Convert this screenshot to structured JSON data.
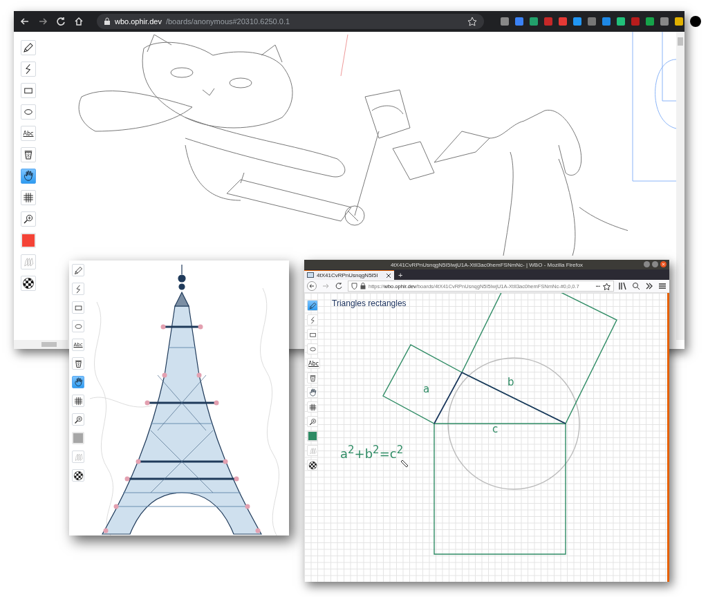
{
  "windows": [
    {
      "kind": "chrome",
      "url_host": "wbo.ophir.dev",
      "url_path": "/boards/anonymous#20310.6250.0.1",
      "tools": [
        {
          "kind": "pencil",
          "selected": false
        },
        {
          "kind": "line",
          "selected": false
        },
        {
          "kind": "rectangle",
          "selected": false
        },
        {
          "kind": "ellipse",
          "selected": false
        },
        {
          "kind": "text",
          "label": "Abc",
          "selected": false
        },
        {
          "kind": "eraser",
          "selected": false
        },
        {
          "kind": "hand",
          "selected": true
        },
        {
          "kind": "grid",
          "selected": false
        },
        {
          "kind": "zoom",
          "selected": false
        },
        {
          "kind": "color",
          "color": "#f44336"
        },
        {
          "kind": "opacity",
          "selected": false
        },
        {
          "kind": "size",
          "selected": false
        }
      ]
    },
    {
      "kind": "panel",
      "tools": [
        {
          "kind": "pencil",
          "selected": false
        },
        {
          "kind": "line",
          "selected": false
        },
        {
          "kind": "rectangle",
          "selected": false
        },
        {
          "kind": "ellipse",
          "selected": false
        },
        {
          "kind": "text",
          "label": "Abc",
          "selected": false
        },
        {
          "kind": "eraser",
          "selected": false
        },
        {
          "kind": "hand",
          "selected": true
        },
        {
          "kind": "grid",
          "selected": false
        },
        {
          "kind": "zoom",
          "selected": false
        },
        {
          "kind": "color",
          "color": "#a6a6a6"
        },
        {
          "kind": "opacity",
          "selected": false
        },
        {
          "kind": "size",
          "selected": false
        }
      ]
    },
    {
      "kind": "firefox",
      "title": "4tX41CvRPnUsnqgN5I5IwjU1A-XtIl3ac0hemFSNmNc- | WBO - Mozilla Firefox",
      "tab": "4tX41CvRPnUsnqgN5I5I",
      "new_tab": "+",
      "url_scheme": "https://",
      "url_host": "wbo.ophir.dev",
      "url_path": "/boards/4tX41CvRPnUsnqgN5I5IwjU1A-XtIl3ac0hemFSNmNc-#0,0,0.7",
      "more": "•••",
      "canvas_texts": [
        {
          "kind": "title",
          "text": "Triangles rectangles"
        },
        {
          "kind": "label_a",
          "text": "a"
        },
        {
          "kind": "label_b",
          "text": "b"
        },
        {
          "kind": "label_c",
          "text": "c"
        },
        {
          "kind": "formula",
          "text": "a$^{2}$+b$^{2}$=c$^{2}$"
        }
      ],
      "tools": [
        {
          "kind": "pencil",
          "selected": true
        },
        {
          "kind": "line",
          "selected": false
        },
        {
          "kind": "rectangle",
          "selected": false
        },
        {
          "kind": "ellipse",
          "selected": false
        },
        {
          "kind": "text",
          "label": "Abc",
          "selected": false
        },
        {
          "kind": "eraser",
          "selected": false
        },
        {
          "kind": "hand",
          "selected": false
        },
        {
          "kind": "grid",
          "selected": false
        },
        {
          "kind": "zoom",
          "selected": false
        },
        {
          "kind": "color",
          "color": "#2e8b64"
        },
        {
          "kind": "opacity",
          "selected": false
        },
        {
          "kind": "size",
          "selected": false
        }
      ]
    }
  ]
}
